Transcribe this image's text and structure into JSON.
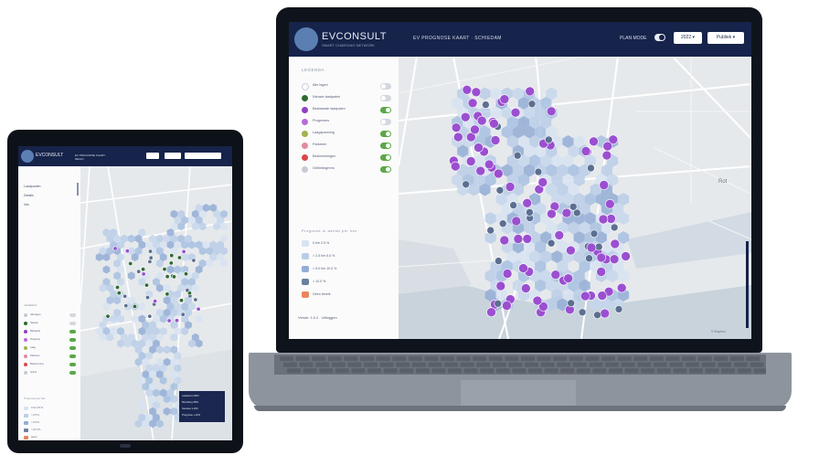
{
  "laptop": {
    "brand": "EVCONSULT",
    "brand_sub": "SMART CHARGING NETWORK",
    "map_title": "EV PROGNOSE KAART · SCHIEDAM",
    "plan_mode_label": "PLAN MODE",
    "year_select": "2022 ▾",
    "publish_select": "Publiek ▾",
    "legend_title": "LEGENDA",
    "legend_items": [
      {
        "label": "Alle lagen",
        "color": "",
        "on": false
      },
      {
        "label": "Nieuwe laadpalen",
        "color": "#2f6b2f",
        "on": false
      },
      {
        "label": "Bestaande laadpalen",
        "color": "#8f3fc4",
        "on": true
      },
      {
        "label": "Prognoses",
        "color": "#b86ad7",
        "on": false
      },
      {
        "label": "Laagspanning",
        "color": "#9fb44a",
        "on": true
      },
      {
        "label": "Parkeren",
        "color": "#e38aa0",
        "on": true
      },
      {
        "label": "Bestemmingen",
        "color": "#d94848",
        "on": true
      },
      {
        "label": "Gebiedsgrens",
        "color": "#c7cbd3",
        "on": true
      }
    ],
    "category_title": "Prognose in aantal per hex",
    "categories": [
      {
        "label": "0 t/m 2.5 %",
        "color": "#d7e3f2"
      },
      {
        "label": "> 2.5 t/m 5.0 %",
        "color": "#b9cde7"
      },
      {
        "label": "> 5.0 t/m 10.0 %",
        "color": "#93add6"
      },
      {
        "label": "> 10.0 %",
        "color": "#6c7f9f"
      },
      {
        "label": "Geen bereik",
        "color": "#e9865f"
      }
    ],
    "version": "Versie: 1.0.2 · Uitloggen",
    "attribution": "© Mapbox"
  },
  "tablet": {
    "brand": "EVCONSULT",
    "title": "EV PROGNOSE KAART · REGIO",
    "nav_items": [
      "Laadpunten",
      "Details",
      "Info"
    ],
    "legend_title": "LEGENDA",
    "legend_items": [
      {
        "label": "Alle lagen",
        "color": "#c7cbd3"
      },
      {
        "label": "Nieuwe",
        "color": "#2f6b2f"
      },
      {
        "label": "Bestaand",
        "color": "#8f3fc4"
      },
      {
        "label": "Prognose",
        "color": "#b86ad7"
      },
      {
        "label": "Laag",
        "color": "#9fb44a"
      },
      {
        "label": "Parkeren",
        "color": "#e38aa0"
      },
      {
        "label": "Bestemming",
        "color": "#d94848"
      },
      {
        "label": "Grens",
        "color": "#c7cbd3"
      }
    ],
    "category_title": "Prognose per hex",
    "categories": [
      {
        "label": "0 t/m 2.5 %",
        "color": "#d7e3f2"
      },
      {
        "label": "> 2.5 %",
        "color": "#b9cde7"
      },
      {
        "label": "> 5.0 %",
        "color": "#93add6"
      },
      {
        "label": "> 10.0 %",
        "color": "#6c7f9f"
      },
      {
        "label": "Geen",
        "color": "#e9865f"
      }
    ],
    "popup": [
      "Laadpunt  2022",
      "Bezetting  68%",
      "Sessies  1.204",
      "Prognose  +12%"
    ]
  }
}
